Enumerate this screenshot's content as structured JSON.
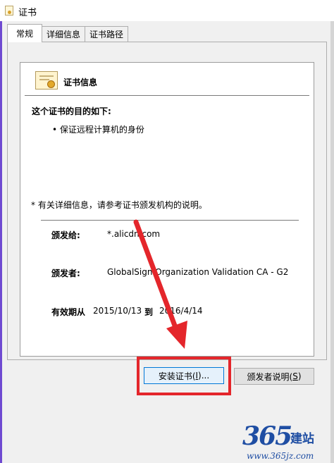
{
  "window": {
    "title": "证书"
  },
  "tabs": [
    {
      "label": "常规",
      "active": true
    },
    {
      "label": "详细信息",
      "active": false
    },
    {
      "label": "证书路径",
      "active": false
    }
  ],
  "cert": {
    "header": "证书信息",
    "purpose_heading": "这个证书的目的如下:",
    "purpose_item": "保证远程计算机的身份",
    "note": "* 有关详细信息，请参考证书颁发机构的说明。",
    "issued_to_label": "颁发给:",
    "issued_to_value": "*.alicdn.com",
    "issued_by_label": "颁发者:",
    "issued_by_value": "GlobalSign Organization Validation CA - G2",
    "validity_label": "有效期从",
    "valid_from": "2015/10/13",
    "to_label": "到",
    "valid_to": "2016/4/14"
  },
  "buttons": {
    "install_prefix": "安装证书(",
    "install_key": "I",
    "install_suffix": ")...",
    "issuer_prefix": "颁发者说明(",
    "issuer_key": "S",
    "issuer_suffix": ")"
  },
  "watermark": {
    "number": "365",
    "brand": "建站",
    "url": "www.365jz.com"
  },
  "colors": {
    "highlight": "#e4262b",
    "arrow": "#e4262b",
    "watermark": "#1f4ea3"
  }
}
